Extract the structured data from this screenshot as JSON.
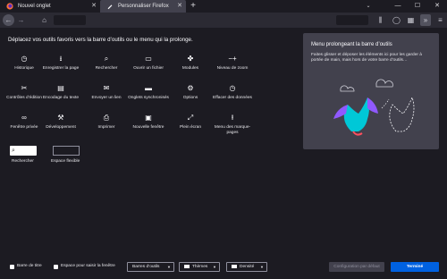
{
  "tabs": [
    {
      "title": "Nouvel onglet",
      "icon": "firefox-icon"
    },
    {
      "title": "Personnaliser Firefox",
      "icon": "brush-icon"
    }
  ],
  "window_controls": {
    "new_tab": "+",
    "list_tabs": "⌄",
    "minimize": "—",
    "maximize": "☐",
    "close": "✕"
  },
  "customize": {
    "heading": "Déplacez vos outils favoris vers la barre d’outils ou le menu qui la prolonge.",
    "tools": [
      {
        "label": "Historique",
        "icon": "history-icon",
        "glyph": "◷"
      },
      {
        "label": "Enregistrer la page",
        "icon": "save-page-icon",
        "glyph": "⭳"
      },
      {
        "label": "Rechercher",
        "icon": "search-icon",
        "glyph": "⌕"
      },
      {
        "label": "Ouvrir un fichier",
        "icon": "open-file-icon",
        "glyph": "▭"
      },
      {
        "label": "Modules",
        "icon": "puzzle-icon",
        "glyph": "✤"
      },
      {
        "label": "Niveau de zoom",
        "icon": "zoom-icon",
        "glyph": "−+"
      },
      {
        "label": "Contrôles d’édition",
        "icon": "edit-controls-icon",
        "glyph": "✂"
      },
      {
        "label": "Encodage du texte",
        "icon": "text-encoding-icon",
        "glyph": "▤"
      },
      {
        "label": "Envoyer un lien",
        "icon": "email-link-icon",
        "glyph": "✉"
      },
      {
        "label": "Onglets synchronisés",
        "icon": "synced-tabs-icon",
        "glyph": "▬"
      },
      {
        "label": "Options",
        "icon": "gear-icon",
        "glyph": "⚙"
      },
      {
        "label": "Effacer des données",
        "icon": "forget-icon",
        "glyph": "◷"
      },
      {
        "label": "Fenêtre privée",
        "icon": "private-window-icon",
        "glyph": "∞"
      },
      {
        "label": "Développement",
        "icon": "developer-icon",
        "glyph": "🔧"
      },
      {
        "label": "Imprimer",
        "icon": "print-icon",
        "glyph": "⎙"
      },
      {
        "label": "Nouvelle fenêtre",
        "icon": "new-window-icon",
        "glyph": "▣"
      },
      {
        "label": "Plein écran",
        "icon": "fullscreen-icon",
        "glyph": "⤢"
      },
      {
        "label": "Menu des marque-pages",
        "icon": "bookmarks-menu-icon",
        "glyph": "⭱"
      }
    ],
    "search_widget_label": "Rechercher",
    "flexible_space_label": "Espace flexible"
  },
  "overflow_panel": {
    "title": "Menu prolongeant la barre d’outils",
    "description": "Faites glisser et déposer les éléments ici pour les garder à portée de main, mais hors de votre barre d’outils…"
  },
  "footer": {
    "title_bar_label": "Barre de titre",
    "drag_space_label": "Espace pour saisir la fenêtre",
    "toolbars_dropdown": "Barres d’outils",
    "themes_dropdown": "Thèmes",
    "density_dropdown": "Densité",
    "restore_defaults": "Configuration par défaut",
    "done": "Terminé"
  },
  "colors": {
    "background": "#1c1b22",
    "toolbar": "#2b2a33",
    "panel": "#42414d",
    "accent": "#0061e0"
  }
}
